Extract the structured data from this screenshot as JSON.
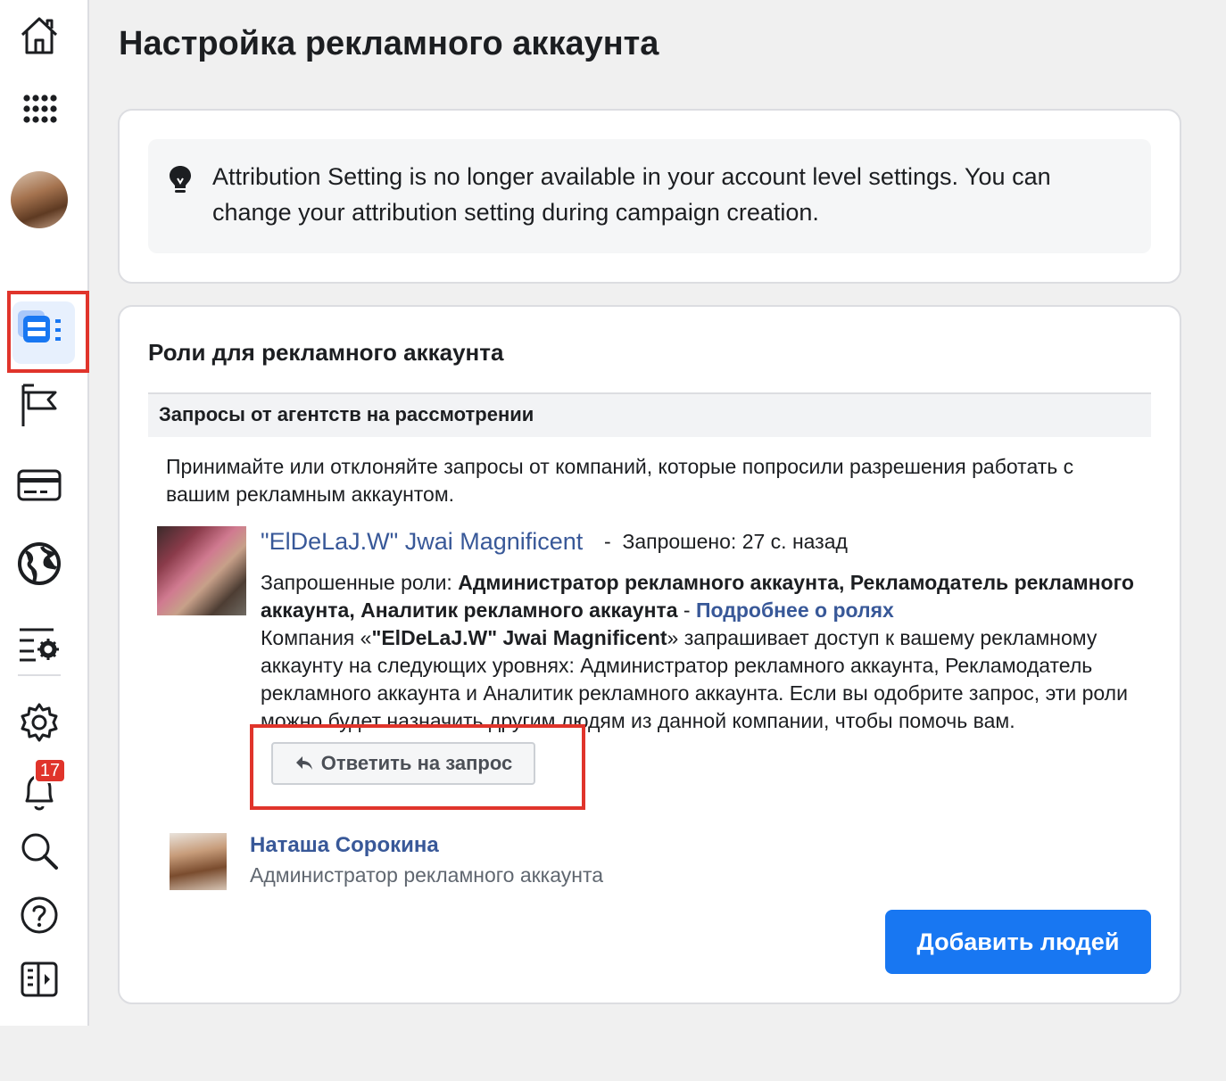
{
  "page": {
    "title": "Настройка рекламного аккаунта"
  },
  "sidebar": {
    "items": [
      {
        "name": "home-icon"
      },
      {
        "name": "apps-grid-icon"
      },
      {
        "name": "profile-avatar"
      },
      {
        "name": "ad-account-settings-icon",
        "active": true
      },
      {
        "name": "flag-icon"
      },
      {
        "name": "billing-card-icon"
      },
      {
        "name": "globe-icon"
      },
      {
        "name": "settings-list-icon"
      },
      {
        "name": "gear-icon"
      },
      {
        "name": "bell-icon",
        "badge": "17"
      },
      {
        "name": "search-icon"
      },
      {
        "name": "help-icon"
      },
      {
        "name": "sidebar-toggle-icon"
      }
    ]
  },
  "notice": {
    "text": "Attribution Setting is no longer available in your account level settings. You can change your attribution setting during campaign creation."
  },
  "roles": {
    "title": "Роли для рекламного аккаунта",
    "pending_header": "Запросы от агентств на рассмотрении",
    "description": "Принимайте или отклоняйте запросы от компаний, которые попросили разрешения работать с вашим рекламным аккаунтом.",
    "request": {
      "company_name": "\"ElDeLaJ.W\" Jwai Magnificent",
      "meta": "Запрошено: 27 с. назад",
      "roles_label": "Запрошенные роли:",
      "roles_value": "Администратор рекламного аккаунта, Рекламодатель рекламного аккаунта, Аналитик рекламного аккаунта",
      "dash": "-",
      "learn_more": "Подробнее о ролях",
      "body_prefix": "Компания «",
      "body_company": "\"ElDeLaJ.W\" Jwai Magnificent",
      "body_suffix": "» запрашивает доступ к вашему рекламному аккаунту на следующих уровнях: Администратор рекламного аккаунта, Рекламодатель рекламного аккаунта и Аналитик рекламного аккаунта. Если вы одобрите запрос, эти роли можно будет назначить другим людям из данной компании, чтобы помочь вам.",
      "reply_button": "Ответить на запрос"
    },
    "person": {
      "name": "Наташа Сорокина",
      "role": "Администратор рекламного аккаунта"
    },
    "add_button": "Добавить людей"
  },
  "colors": {
    "accent": "#1877f2",
    "link": "#385898",
    "highlight": "#e0342b",
    "badge": "#e0342b"
  }
}
